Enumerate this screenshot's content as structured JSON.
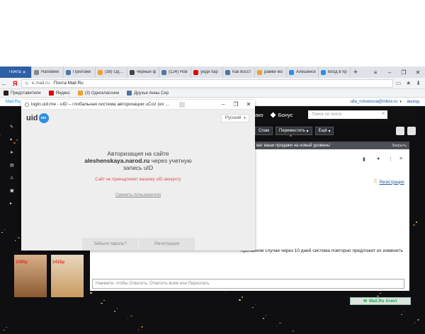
{
  "browser": {
    "tabs": [
      {
        "label": "Почта",
        "active": true,
        "color": "#2f5fa6"
      },
      {
        "label": "Напомин",
        "color": "#888888"
      },
      {
        "label": "Приложе",
        "color": "#4a76a8"
      },
      {
        "label": "(38) Однок",
        "color": "#f0a030"
      },
      {
        "label": "чёрный ф",
        "color": "#444444"
      },
      {
        "label": "(124) Нов",
        "color": "#4a76a8"
      },
      {
        "label": "уйди пар",
        "color": "#e00000"
      },
      {
        "label": "Как восст",
        "color": "#4a76a8"
      },
      {
        "label": "рамки мо",
        "color": "#e8a23a"
      },
      {
        "label": "Алешенск",
        "color": "#2f8ee0"
      },
      {
        "label": "Вход в пр",
        "color": "#2f8ee0"
      }
    ],
    "new_tab": "+",
    "window_controls": [
      "≡",
      "–",
      "❐",
      "✕"
    ],
    "back": "←",
    "yandex_logo": "Я",
    "address": {
      "domain": "e.mail.ru",
      "title": "Почта Mail.Ru"
    },
    "bookmarks": [
      {
        "label": "Представители",
        "color": "#222222"
      },
      {
        "label": "Яндекс",
        "color": "#e00000"
      },
      {
        "label": "(3) Одноклассник",
        "color": "#f0a030"
      },
      {
        "label": "Друзья Анны Сер",
        "color": "#4a76a8"
      }
    ]
  },
  "mailru": {
    "logo": "Mail.Ru",
    "user": "ulia_romanova@inbox.ru",
    "exit": "выход",
    "header_fragment": "ако",
    "bonus": "Бонус",
    "search_placeholder": "Поиск по почте",
    "toolbar": {
      "spam": "Спам",
      "move": "Переместить",
      "more": "Ещё"
    },
    "notice": "ват ваши продажи на новый уровень!",
    "notice_close": "Закрыть",
    "register_link": "Регистрация",
    "warning_text": "противном случае через 10 дней система повторно предложит их изменить",
    "warning_prefix": "изменить",
    "reply_placeholder": "Нажмите, чтобы Ответить, Ответить всем или Переслать",
    "agent": "Mail.Ru Агент",
    "ad_prices": [
      "1090р",
      "1415р"
    ]
  },
  "popup": {
    "url": "login.uid.me",
    "url_title": "uID – глобальная система авторизации uCoz (ex ...",
    "logo_text": "uid",
    "logo_badge": "me",
    "language": "Русский",
    "title_line1": "Авторизация на сайте",
    "site": "aleshenskaya.narod.ru",
    "title_line2": "через учетную",
    "title_line3": "запись uID",
    "error": "Сайт не принадлежит вашему uID-аккаунту",
    "switch_user": "Сменить пользователя",
    "forgot": "Забыли пароль?",
    "register": "Регистрация"
  }
}
